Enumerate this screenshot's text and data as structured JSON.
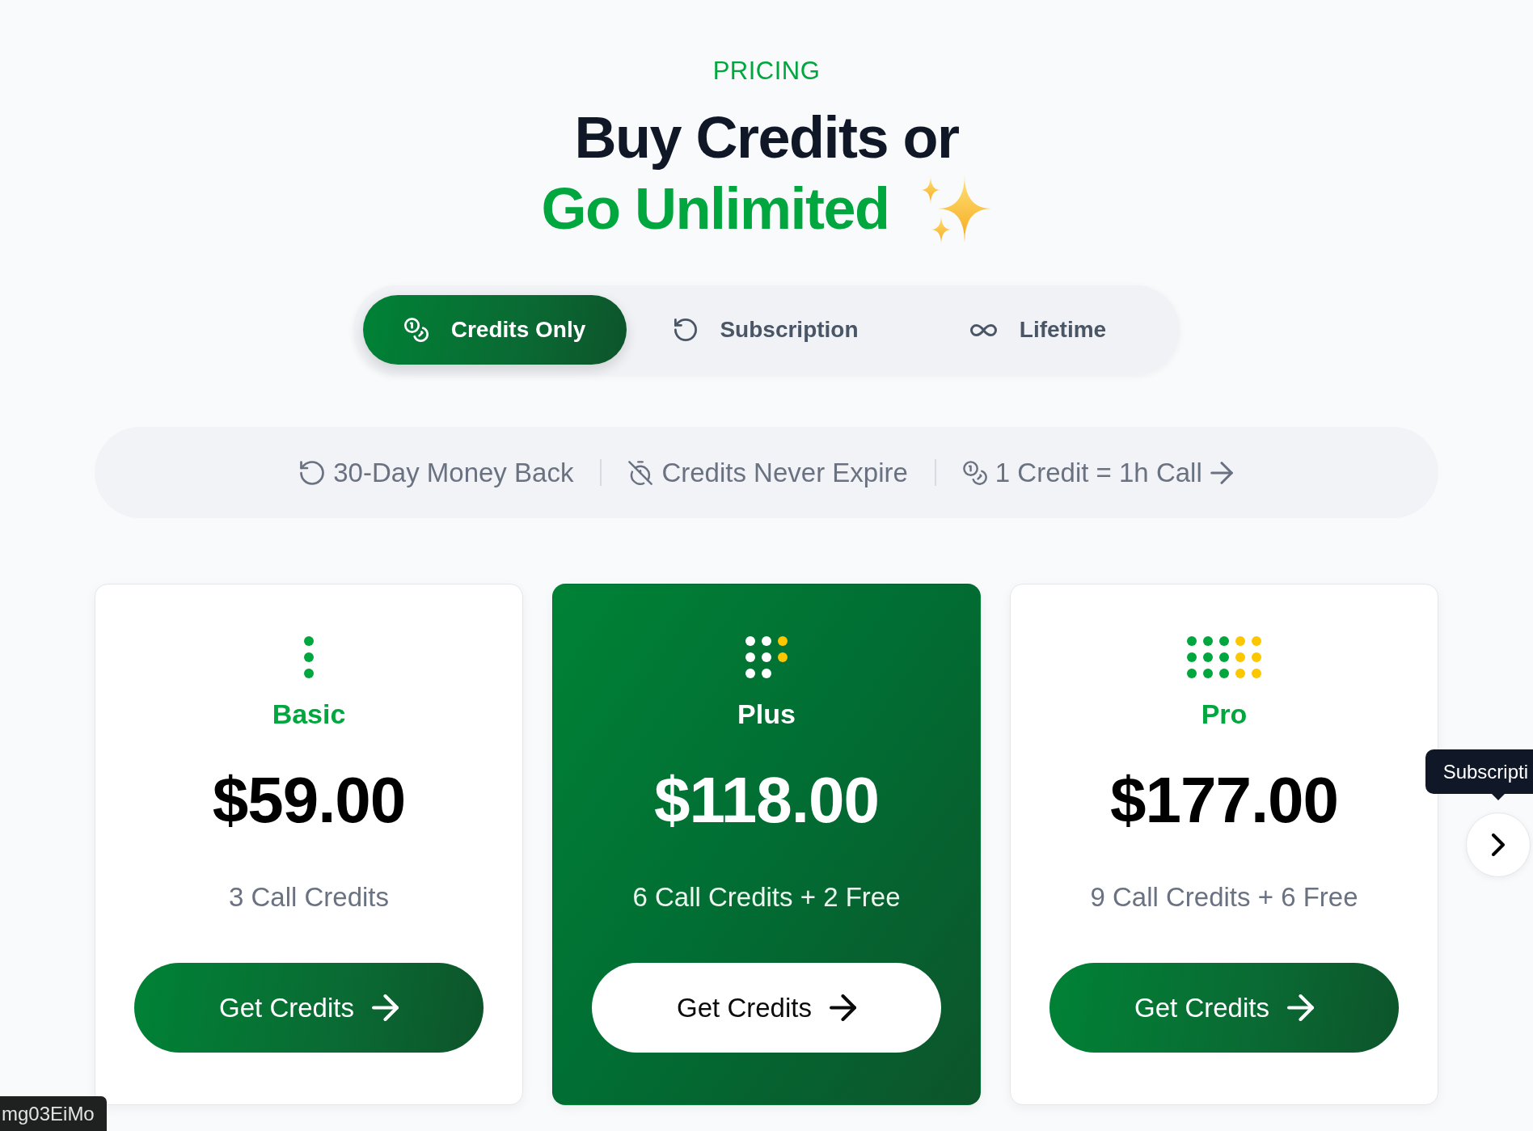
{
  "header": {
    "eyebrow": "PRICING",
    "title_line_1": "Buy Credits or",
    "title_line_2": "Go Unlimited"
  },
  "plan_tabs": [
    {
      "label": "Credits Only",
      "selected": true
    },
    {
      "label": "Subscription",
      "selected": false
    },
    {
      "label": "Lifetime",
      "selected": false
    }
  ],
  "features": [
    {
      "kind": "text",
      "label": "30-Day Money Back"
    },
    {
      "kind": "text",
      "label": "Credits Never Expire"
    },
    {
      "kind": "link",
      "label": "1 Credit = 1h Call"
    }
  ],
  "plans": [
    {
      "name": "Basic",
      "price": "$59.00",
      "credits": "3 Call Credits",
      "button": "Get Credits",
      "featured": false
    },
    {
      "name": "Plus",
      "price": "$118.00",
      "credits": "6 Call Credits + 2 Free",
      "button": "Get Credits",
      "featured": true
    },
    {
      "name": "Pro",
      "price": "$177.00",
      "credits": "9 Call Credits + 6 Free",
      "button": "Get Credits",
      "featured": false
    }
  ],
  "carousel": {
    "next_tooltip": "Subscripti"
  },
  "status_bar": {
    "url": "mg03EiMo"
  }
}
